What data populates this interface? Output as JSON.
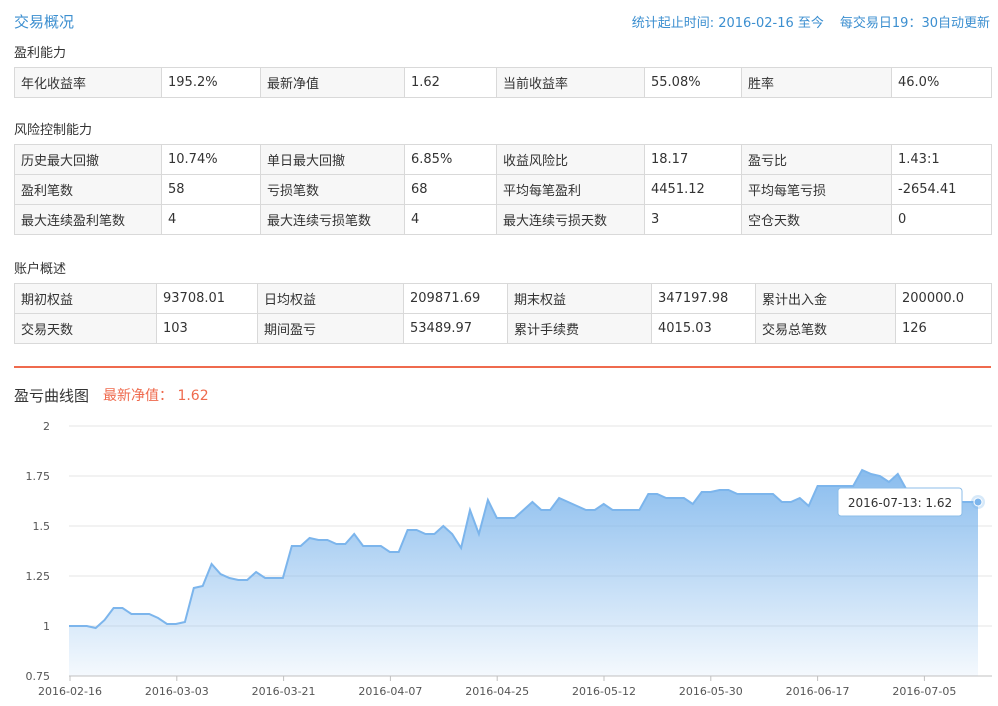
{
  "header": {
    "title": "交易概况",
    "stats_since": "统计起止时间: 2016-02-16 至今",
    "update_note": "每交易日19：30自动更新"
  },
  "profit": {
    "title": "盈利能力",
    "rows": [
      [
        {
          "label": "年化收益率",
          "value": "195.2%"
        },
        {
          "label": "最新净值",
          "value": "1.62"
        },
        {
          "label": "当前收益率",
          "value": "55.08%"
        },
        {
          "label": "胜率",
          "value": "46.0%"
        }
      ]
    ]
  },
  "risk": {
    "title": "风险控制能力",
    "rows": [
      [
        {
          "label": "历史最大回撤",
          "value": "10.74%"
        },
        {
          "label": "单日最大回撤",
          "value": "6.85%"
        },
        {
          "label": "收益风险比",
          "value": "18.17"
        },
        {
          "label": "盈亏比",
          "value": "1.43:1"
        }
      ],
      [
        {
          "label": "盈利笔数",
          "value": "58"
        },
        {
          "label": "亏损笔数",
          "value": "68"
        },
        {
          "label": "平均每笔盈利",
          "value": "4451.12"
        },
        {
          "label": "平均每笔亏损",
          "value": "-2654.41"
        }
      ],
      [
        {
          "label": "最大连续盈利笔数",
          "value": "4"
        },
        {
          "label": "最大连续亏损笔数",
          "value": "4"
        },
        {
          "label": "最大连续亏损天数",
          "value": "3"
        },
        {
          "label": "空仓天数",
          "value": "0"
        }
      ]
    ]
  },
  "account": {
    "title": "账户概述",
    "rows": [
      [
        {
          "label": "期初权益",
          "value": "93708.01"
        },
        {
          "label": "日均权益",
          "value": "209871.69"
        },
        {
          "label": "期末权益",
          "value": "347197.98"
        },
        {
          "label": "累计出入金",
          "value": "200000.0"
        }
      ],
      [
        {
          "label": "交易天数",
          "value": "103"
        },
        {
          "label": "期间盈亏",
          "value": "53489.97"
        },
        {
          "label": "累计手续费",
          "value": "4015.03"
        },
        {
          "label": "交易总笔数",
          "value": "126"
        }
      ]
    ]
  },
  "chart_section": {
    "title": "盈亏曲线图",
    "subtitle": "最新净值： 1.62"
  },
  "colors": {
    "accent_blue": "#3c8fd0",
    "accent_red": "#ef6a4d",
    "line_blue": "#7cb5ec"
  },
  "chart_data": {
    "type": "area",
    "title": "",
    "xlabel": "",
    "ylabel": "",
    "ylim": [
      0.75,
      2
    ],
    "y_ticks": [
      "0.75",
      "1",
      "1.25",
      "1.5",
      "1.75",
      "2"
    ],
    "x_tick_labels": [
      "2016-02-16",
      "2016-03-03",
      "2016-03-21",
      "2016-04-07",
      "2016-04-25",
      "2016-05-12",
      "2016-05-30",
      "2016-06-17",
      "2016-07-05"
    ],
    "grid": "horizontal",
    "series": [
      {
        "values": [
          1.0,
          1.0,
          1.0,
          0.99,
          1.03,
          1.09,
          1.09,
          1.06,
          1.06,
          1.06,
          1.04,
          1.01,
          1.01,
          1.02,
          1.19,
          1.2,
          1.31,
          1.26,
          1.24,
          1.23,
          1.23,
          1.27,
          1.24,
          1.24,
          1.24,
          1.4,
          1.4,
          1.44,
          1.43,
          1.43,
          1.41,
          1.41,
          1.46,
          1.4,
          1.4,
          1.4,
          1.37,
          1.37,
          1.48,
          1.48,
          1.46,
          1.46,
          1.5,
          1.46,
          1.39,
          1.58,
          1.46,
          1.63,
          1.54,
          1.54,
          1.54,
          1.58,
          1.62,
          1.58,
          1.58,
          1.64,
          1.62,
          1.6,
          1.58,
          1.58,
          1.61,
          1.58,
          1.58,
          1.58,
          1.58,
          1.66,
          1.66,
          1.64,
          1.64,
          1.64,
          1.61,
          1.67,
          1.67,
          1.68,
          1.68,
          1.66,
          1.66,
          1.66,
          1.66,
          1.66,
          1.62,
          1.62,
          1.64,
          1.6,
          1.7,
          1.7,
          1.7,
          1.7,
          1.7,
          1.78,
          1.76,
          1.75,
          1.72,
          1.76,
          1.68,
          1.66,
          1.64,
          1.62,
          1.63,
          1.62,
          1.62,
          1.62,
          1.62
        ]
      }
    ],
    "tooltip": {
      "date": "2016-07-13",
      "value": 1.62,
      "text": "2016-07-13: 1.62"
    }
  }
}
